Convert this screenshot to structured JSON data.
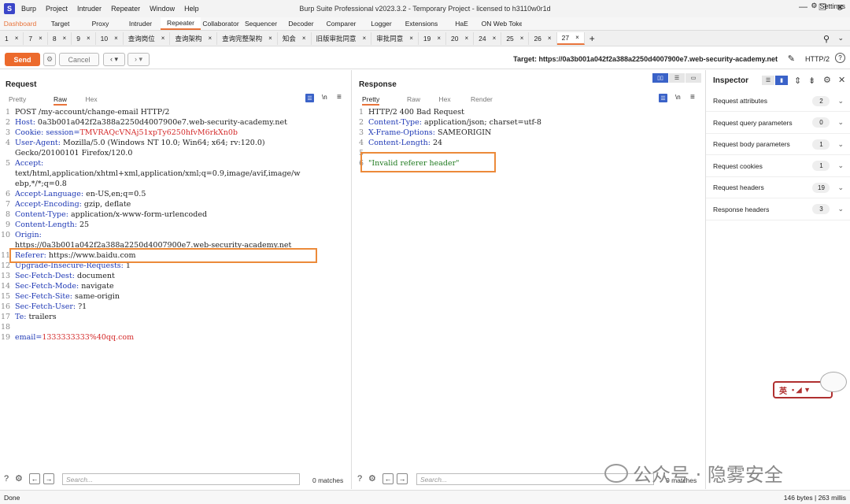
{
  "titlebar": {
    "app_name": "Burp",
    "menu": [
      "Burp",
      "Project",
      "Intruder",
      "Repeater",
      "Window",
      "Help"
    ],
    "title": "Burp Suite Professional v2023.3.2 - Temporary Project - licensed to h3110w0r1d"
  },
  "tool_tabs": [
    "Dashboard",
    "Target",
    "Proxy",
    "Intruder",
    "Repeater",
    "Collaborator",
    "Sequencer",
    "Decoder",
    "Comparer",
    "Logger",
    "Extensions",
    "HaE",
    "JSON Web Tokens"
  ],
  "active_tool_tab": "Repeater",
  "settings_label": "Settings",
  "repeater_tabs": [
    "1",
    "7",
    "8",
    "9",
    "10",
    "查询岗位",
    "查询架构",
    "查询完整架构",
    "知会",
    "旧版审批同意",
    "审批同意",
    "19",
    "20",
    "24",
    "25",
    "26",
    "27"
  ],
  "active_repeater_tab": "27",
  "toolbar": {
    "send_label": "Send",
    "cancel_label": "Cancel",
    "target_label": "Target: https://0a3b001a042f2a388a2250d4007900e7.web-security-academy.net",
    "http_version": "HTTP/2"
  },
  "request": {
    "title": "Request",
    "view_tabs": [
      "Pretty",
      "Raw",
      "Hex"
    ],
    "active_view": "Raw",
    "lines": [
      {
        "n": "1",
        "parts": [
          {
            "t": "POST /my-account/change-email HTTP/2",
            "c": "hv"
          }
        ]
      },
      {
        "n": "2",
        "parts": [
          {
            "t": "Host: ",
            "c": "hk"
          },
          {
            "t": "0a3b001a042f2a388a2250d4007900e7.web-security-academy.net",
            "c": "hv"
          }
        ]
      },
      {
        "n": "3",
        "parts": [
          {
            "t": "Cookie: session=",
            "c": "hk"
          },
          {
            "t": "TMVRAQcVNAj51xpTy6250hfvM6rkXn0b",
            "c": "red"
          }
        ]
      },
      {
        "n": "4",
        "parts": [
          {
            "t": "User-Agent: ",
            "c": "hk"
          },
          {
            "t": "Mozilla/5.0 (Windows NT 10.0; Win64; x64; rv:120.0)",
            "c": "hv"
          }
        ]
      },
      {
        "n": "",
        "parts": [
          {
            "t": "Gecko/20100101 Firefox/120.0",
            "c": "hv"
          }
        ]
      },
      {
        "n": "5",
        "parts": [
          {
            "t": "Accept:",
            "c": "hk"
          }
        ]
      },
      {
        "n": "",
        "parts": [
          {
            "t": "text/html,application/xhtml+xml,application/xml;q=0.9,image/avif,image/w",
            "c": "hv"
          }
        ]
      },
      {
        "n": "",
        "parts": [
          {
            "t": "ebp,*/*;q=0.8",
            "c": "hv"
          }
        ]
      },
      {
        "n": "6",
        "parts": [
          {
            "t": "Accept-Language: ",
            "c": "hk"
          },
          {
            "t": "en-US,en;q=0.5",
            "c": "hv"
          }
        ]
      },
      {
        "n": "7",
        "parts": [
          {
            "t": "Accept-Encoding: ",
            "c": "hk"
          },
          {
            "t": "gzip, deflate",
            "c": "hv"
          }
        ]
      },
      {
        "n": "8",
        "parts": [
          {
            "t": "Content-Type: ",
            "c": "hk"
          },
          {
            "t": "application/x-www-form-urlencoded",
            "c": "hv"
          }
        ]
      },
      {
        "n": "9",
        "parts": [
          {
            "t": "Content-Length: ",
            "c": "hk"
          },
          {
            "t": "25",
            "c": "hv"
          }
        ]
      },
      {
        "n": "10",
        "parts": [
          {
            "t": "Origin:",
            "c": "hk"
          }
        ]
      },
      {
        "n": "",
        "parts": [
          {
            "t": "https://0a3b001a042f2a388a2250d4007900e7.web-security-academy.net",
            "c": "hv"
          }
        ]
      },
      {
        "n": "11",
        "parts": [
          {
            "t": "Referer: ",
            "c": "hk"
          },
          {
            "t": "https://www.baidu.com",
            "c": "hv"
          }
        ]
      },
      {
        "n": "12",
        "parts": [
          {
            "t": "Upgrade-Insecure-Requests: ",
            "c": "hk"
          },
          {
            "t": "1",
            "c": "hv"
          }
        ]
      },
      {
        "n": "13",
        "parts": [
          {
            "t": "Sec-Fetch-Dest: ",
            "c": "hk"
          },
          {
            "t": "document",
            "c": "hv"
          }
        ]
      },
      {
        "n": "14",
        "parts": [
          {
            "t": "Sec-Fetch-Mode: ",
            "c": "hk"
          },
          {
            "t": "navigate",
            "c": "hv"
          }
        ]
      },
      {
        "n": "15",
        "parts": [
          {
            "t": "Sec-Fetch-Site: ",
            "c": "hk"
          },
          {
            "t": "same-origin",
            "c": "hv"
          }
        ]
      },
      {
        "n": "16",
        "parts": [
          {
            "t": "Sec-Fetch-User: ",
            "c": "hk"
          },
          {
            "t": "?1",
            "c": "hv"
          }
        ]
      },
      {
        "n": "17",
        "parts": [
          {
            "t": "Te: ",
            "c": "hk"
          },
          {
            "t": "trailers",
            "c": "hv"
          }
        ]
      },
      {
        "n": "18",
        "parts": [
          {
            "t": "",
            "c": "hv"
          }
        ]
      },
      {
        "n": "19",
        "parts": [
          {
            "t": "email=",
            "c": "hk"
          },
          {
            "t": "1333333333%40qq.com",
            "c": "red"
          }
        ]
      }
    ],
    "search_placeholder": "Search...",
    "matches": "0 matches"
  },
  "response": {
    "title": "Response",
    "view_tabs": [
      "Pretty",
      "Raw",
      "Hex",
      "Render"
    ],
    "active_view": "Pretty",
    "lines": [
      {
        "n": "1",
        "parts": [
          {
            "t": "HTTP/2 400 Bad Request",
            "c": "hv"
          }
        ]
      },
      {
        "n": "2",
        "parts": [
          {
            "t": "Content-Type: ",
            "c": "hk"
          },
          {
            "t": "application/json; charset=utf-8",
            "c": "hv"
          }
        ]
      },
      {
        "n": "3",
        "parts": [
          {
            "t": "X-Frame-Options: ",
            "c": "hk"
          },
          {
            "t": "SAMEORIGIN",
            "c": "hv"
          }
        ]
      },
      {
        "n": "4",
        "parts": [
          {
            "t": "Content-Length: ",
            "c": "hk"
          },
          {
            "t": "24",
            "c": "hv"
          }
        ]
      },
      {
        "n": "5",
        "parts": [
          {
            "t": "",
            "c": "hv"
          }
        ]
      },
      {
        "n": "6",
        "parts": [
          {
            "t": "\"Invalid referer header\"",
            "c": "jstr"
          }
        ]
      }
    ],
    "search_placeholder": "Search...",
    "matches": "0 matches"
  },
  "inspector": {
    "title": "Inspector",
    "rows": [
      {
        "label": "Request attributes",
        "count": "2"
      },
      {
        "label": "Request query parameters",
        "count": "0"
      },
      {
        "label": "Request body parameters",
        "count": "1"
      },
      {
        "label": "Request cookies",
        "count": "1"
      },
      {
        "label": "Request headers",
        "count": "19"
      },
      {
        "label": "Response headers",
        "count": "3"
      }
    ]
  },
  "watermark": "公众号 · 隐雾安全",
  "ime_badge": "英",
  "status": {
    "left": "Done",
    "right": "146 bytes | 263 millis"
  },
  "colors": {
    "accent": "#e8743b",
    "send": "#ec6a2c",
    "highlight": "#ec8a3a",
    "header_key": "#1f39b5",
    "value_red": "#d42a2a"
  }
}
